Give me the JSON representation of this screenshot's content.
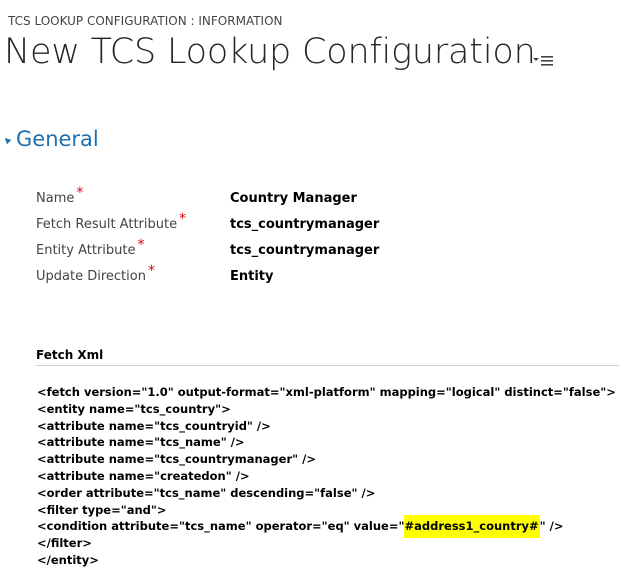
{
  "header": {
    "entity_label": "TCS LOOKUP CONFIGURATION : INFORMATION",
    "record_title": "New TCS Lookup Configuration",
    "menu_icon": "list-menu-icon"
  },
  "section": {
    "title": "General",
    "toggle_icon": "collapse-triangle-icon",
    "accent_color": "#1f6fad"
  },
  "fields": [
    {
      "label": "Name",
      "required": "*",
      "value": "Country Manager"
    },
    {
      "label": "Fetch Result Attribute",
      "required": "*",
      "value": "tcs_countrymanager"
    },
    {
      "label": "Entity Attribute",
      "required": "*",
      "value": "tcs_countrymanager"
    },
    {
      "label": "Update Direction",
      "required": "*",
      "value": "Entity"
    }
  ],
  "required_color": "#e0001b",
  "fetch_xml": {
    "label": "Fetch Xml",
    "lines": [
      "<fetch version=\"1.0\" output-format=\"xml-platform\" mapping=\"logical\" distinct=\"false\">",
      "<entity name=\"tcs_country\">",
      "<attribute name=\"tcs_countryid\" />",
      "<attribute name=\"tcs_name\" />",
      "<attribute name=\"tcs_countrymanager\" />",
      "<attribute name=\"createdon\" />",
      "<order attribute=\"tcs_name\" descending=\"false\" />",
      "<filter type=\"and\">"
    ],
    "condition_prefix": "<condition attribute=\"tcs_name\" operator=\"eq\" value=\"",
    "condition_highlight": "#address1_country#",
    "condition_suffix": "\" />",
    "closing_lines": [
      "</filter>",
      "</entity>"
    ],
    "highlight_color": "#ffff00"
  }
}
